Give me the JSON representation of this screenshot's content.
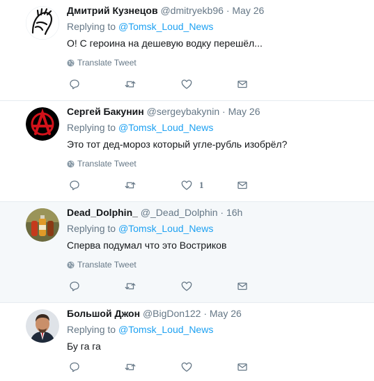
{
  "tweets": [
    {
      "fullname": "Дмитрий Кузнецов",
      "username": "@dmitryekb96",
      "separator": "·",
      "time": "May 26",
      "replying_prefix": "Replying to",
      "replying_to": "@Tomsk_Loud_News",
      "text": "О! С героина на дешевую водку перешёл...",
      "translate": "Translate Tweet",
      "like_count": ""
    },
    {
      "fullname": "Сергей Бакунин",
      "username": "@sergeybakynin",
      "separator": "·",
      "time": "May 26",
      "replying_prefix": "Replying to",
      "replying_to": "@Tomsk_Loud_News",
      "text": "Это тот дед-мороз который угле-рубль  изобрёл?",
      "translate": "Translate Tweet",
      "like_count": "1"
    },
    {
      "fullname": "Dead_Dolphin_",
      "username": "@_Dead_Dolphin",
      "separator": "·",
      "time": "16h",
      "replying_prefix": "Replying to",
      "replying_to": "@Tomsk_Loud_News",
      "text": "Сперва подумал что это  Востриков",
      "translate": "Translate Tweet",
      "like_count": ""
    },
    {
      "fullname": "Большой Джон",
      "username": "@BigDon122",
      "separator": "·",
      "time": "May 26",
      "replying_prefix": "Replying to",
      "replying_to": "@Tomsk_Loud_News",
      "text": "Бу га га",
      "translate": "",
      "like_count": ""
    }
  ],
  "colors": {
    "link": "#1da1f2",
    "secondary_text": "#657786",
    "primary_text": "#14171a",
    "highlight_bg": "#f5f8fa",
    "divider": "#e6ecf0"
  }
}
